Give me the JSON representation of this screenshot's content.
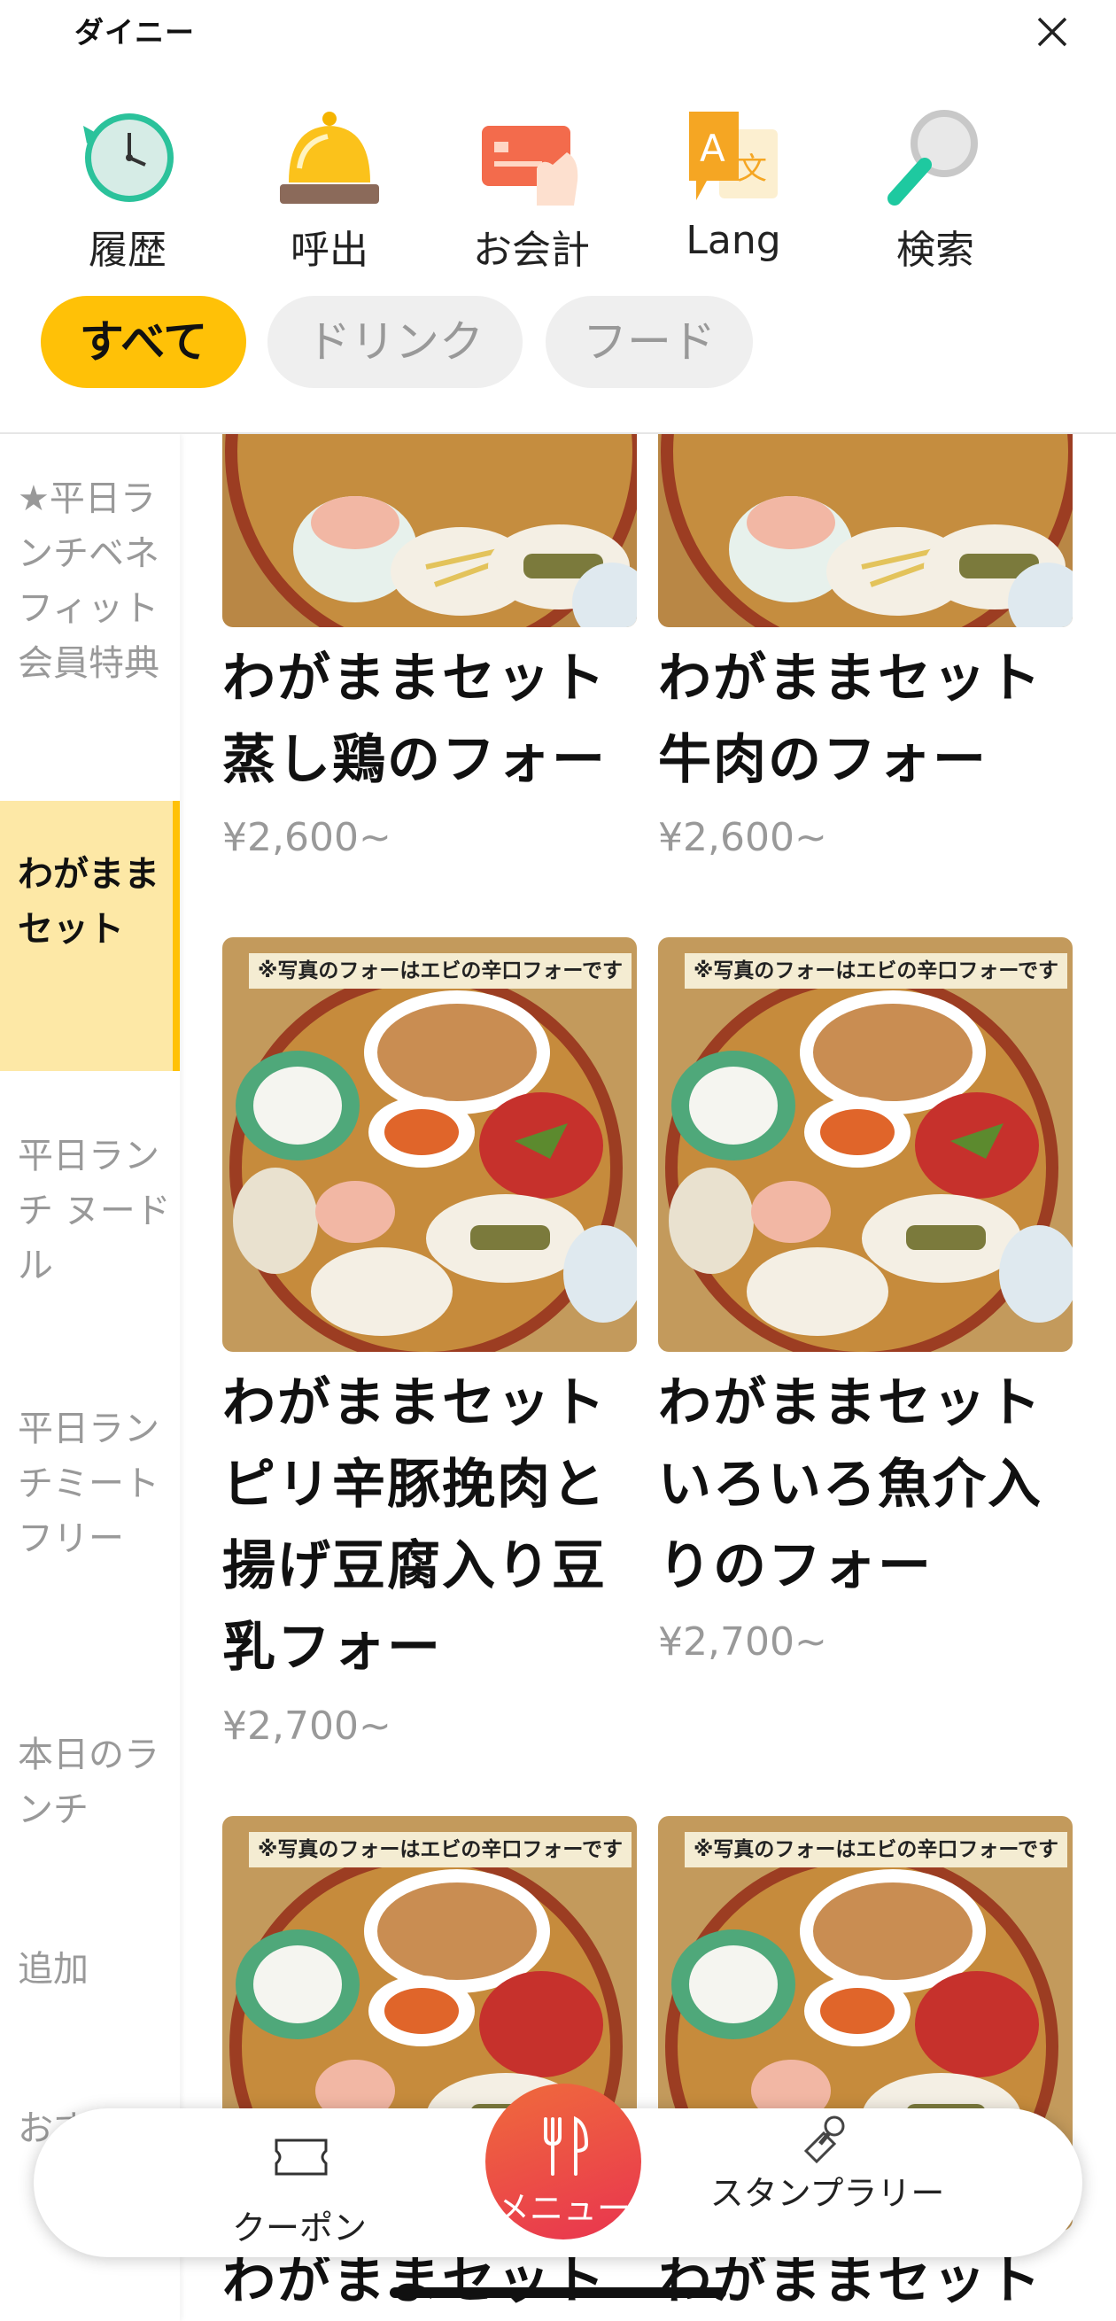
{
  "header": {
    "title": "ダイニー",
    "close_icon": "close-icon",
    "tools": [
      {
        "label": "履歴",
        "icon": "history-clock-icon"
      },
      {
        "label": "呼出",
        "icon": "call-bell-icon"
      },
      {
        "label": "お会計",
        "icon": "payment-card-icon"
      },
      {
        "label": "Lang",
        "icon": "language-icon"
      },
      {
        "label": "検索",
        "icon": "search-icon"
      }
    ],
    "categories": [
      {
        "label": "すべて",
        "selected": true
      },
      {
        "label": "ドリンク",
        "selected": false
      },
      {
        "label": "フード",
        "selected": false
      }
    ]
  },
  "sidebar": {
    "items": [
      {
        "label": "★平日ランチベネフィット会員特典",
        "active": false
      },
      {
        "label": "わがままセット",
        "active": true
      },
      {
        "label": "平日ランチ ヌードル",
        "active": false
      },
      {
        "label": "平日ランチミートフリー",
        "active": false
      },
      {
        "label": "本日のランチ",
        "active": false
      },
      {
        "label": "追加",
        "active": false
      },
      {
        "label": "おすすめ",
        "active": false
      }
    ]
  },
  "menu": {
    "notice": "※写真のフォーはエビの辛口フォーです",
    "items": [
      {
        "name": "わがままセット蒸し鶏のフォー",
        "price": "¥2,600~"
      },
      {
        "name": "わがままセット牛肉のフォー",
        "price": "¥2,600~"
      },
      {
        "name": "わがままセットピリ辛豚挽肉と揚げ豆腐入り豆乳フォー",
        "price": "¥2,700~"
      },
      {
        "name": "わがままセットいろいろ魚介入りのフォー",
        "price": "¥2,700~"
      },
      {
        "name": "わがままセット",
        "price": ""
      },
      {
        "name": "わがままセット",
        "price": ""
      }
    ]
  },
  "bottom_nav": {
    "coupon": "クーポン",
    "menu": "メニュー",
    "stamp": "スタンプラリー"
  },
  "colors": {
    "accent": "#ffc107",
    "sidebar_active_bg": "#fde8a6",
    "fab_start": "#ef6b3c",
    "fab_end": "#e9344f"
  }
}
